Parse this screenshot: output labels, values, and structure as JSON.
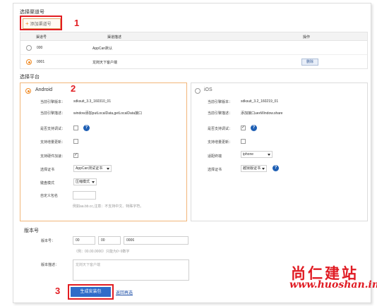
{
  "channel_section": {
    "title": "选择渠道号",
    "add_button": "添加渠道号",
    "table": {
      "headers": [
        "渠道号",
        "渠道描述",
        "操作"
      ],
      "rows": [
        {
          "code": "000",
          "desc": "AppCan默认",
          "selected": false,
          "action": ""
        },
        {
          "code": "0001",
          "desc": "龙岗天下客户端",
          "selected": true,
          "action": "删除"
        }
      ]
    }
  },
  "platform_section": {
    "title": "选择平台",
    "android": {
      "name": "Android",
      "selected": true,
      "engine_version_label": "当前引擎版本：",
      "engine_version": "sdksuit_3.3_160310_01",
      "engine_desc_label": "当前引擎描述：",
      "engine_desc": "window添加putLocalData,getLocalData接口",
      "debug_label": "是否支持调试：",
      "incremental_label": "支持增量更新：",
      "hw_accel_label": "支持硬件加速：",
      "cert_label": "选择证书",
      "cert_value": "AppCan测试证书",
      "keyboard_label": "键盘模式",
      "keyboard_value": "压缩模式",
      "package_label": "自定义包名",
      "package_hint": "例如aa.bb.cc,注意：不支持中文、特殊字符。"
    },
    "ios": {
      "name": "iOS",
      "selected": false,
      "engine_version_label": "当前引擎版本：",
      "engine_version": "sdksuit_3.2_160219_01",
      "engine_desc_label": "当前引擎描述：",
      "engine_desc": "添加接口uexWindow.share",
      "debug_label": "是否支持调试：",
      "incremental_label": "支持增量更新：",
      "device_label": "适配终端",
      "device_value": "iphone",
      "cert_label": "选择证书",
      "cert_value": "越狱版证书"
    }
  },
  "version_section": {
    "title": "版本号",
    "version_label": "版本号：",
    "major": "00",
    "minor": "00",
    "patch": "0006",
    "version_hint": "（例：00.00.0000）只能为0~9数字",
    "desc_label": "版本描述：",
    "desc_placeholder": "龙岗天下客户端"
  },
  "actions": {
    "generate": "生成安装包",
    "reselect": "返回再选"
  },
  "annotations": {
    "step1": "1",
    "step2": "2",
    "step3": "3"
  },
  "watermark": {
    "brand": "尚仁建站",
    "url": "www.huoshan.info"
  },
  "colors": {
    "accent": "#f08a24",
    "primary": "#2f6cc9",
    "annotation": "#e21d22",
    "help": "#1e5fb4"
  }
}
